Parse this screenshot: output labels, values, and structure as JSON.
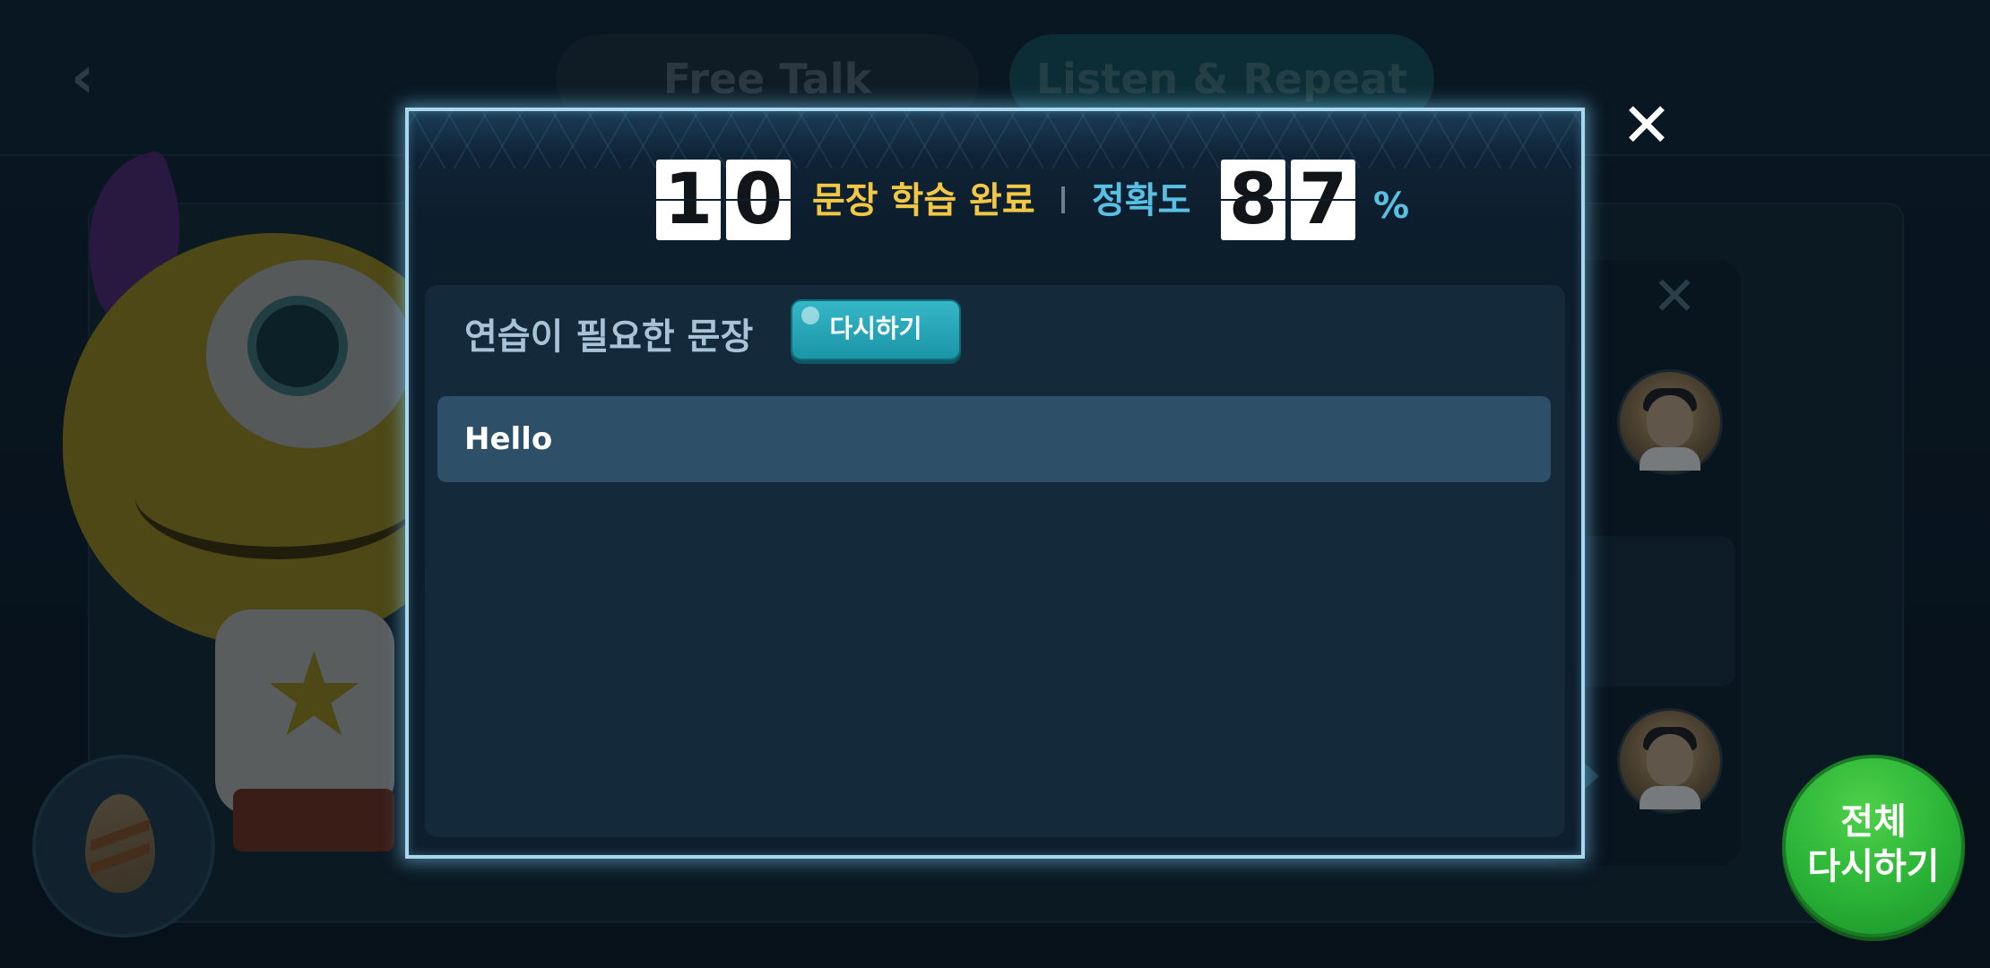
{
  "background": {
    "tabs": [
      {
        "label": "Free Talk"
      },
      {
        "label": "Listen & Repeat"
      }
    ],
    "back_icon": "chevron-left-icon",
    "side_close_icon": "close-icon",
    "side_avatar_icon": "avatar"
  },
  "modal": {
    "close_icon": "close-icon",
    "completed_digits": [
      "1",
      "0"
    ],
    "completed_label": "문장 학습 완료",
    "accuracy_label": "정확도",
    "accuracy_digits": [
      "8",
      "7"
    ],
    "percent_sign": "%",
    "needs_practice": {
      "title": "연습이 필요한 문장",
      "retry_label": "다시하기",
      "sentences": [
        "Hello"
      ]
    }
  },
  "retry_all": {
    "line1": "전체",
    "line2": "다시하기"
  },
  "colors": {
    "accent_yellow": "#f2c744",
    "accent_blue": "#59c0e4",
    "retry_teal": "#1b95a8",
    "retry_all_green": "#29b336"
  }
}
